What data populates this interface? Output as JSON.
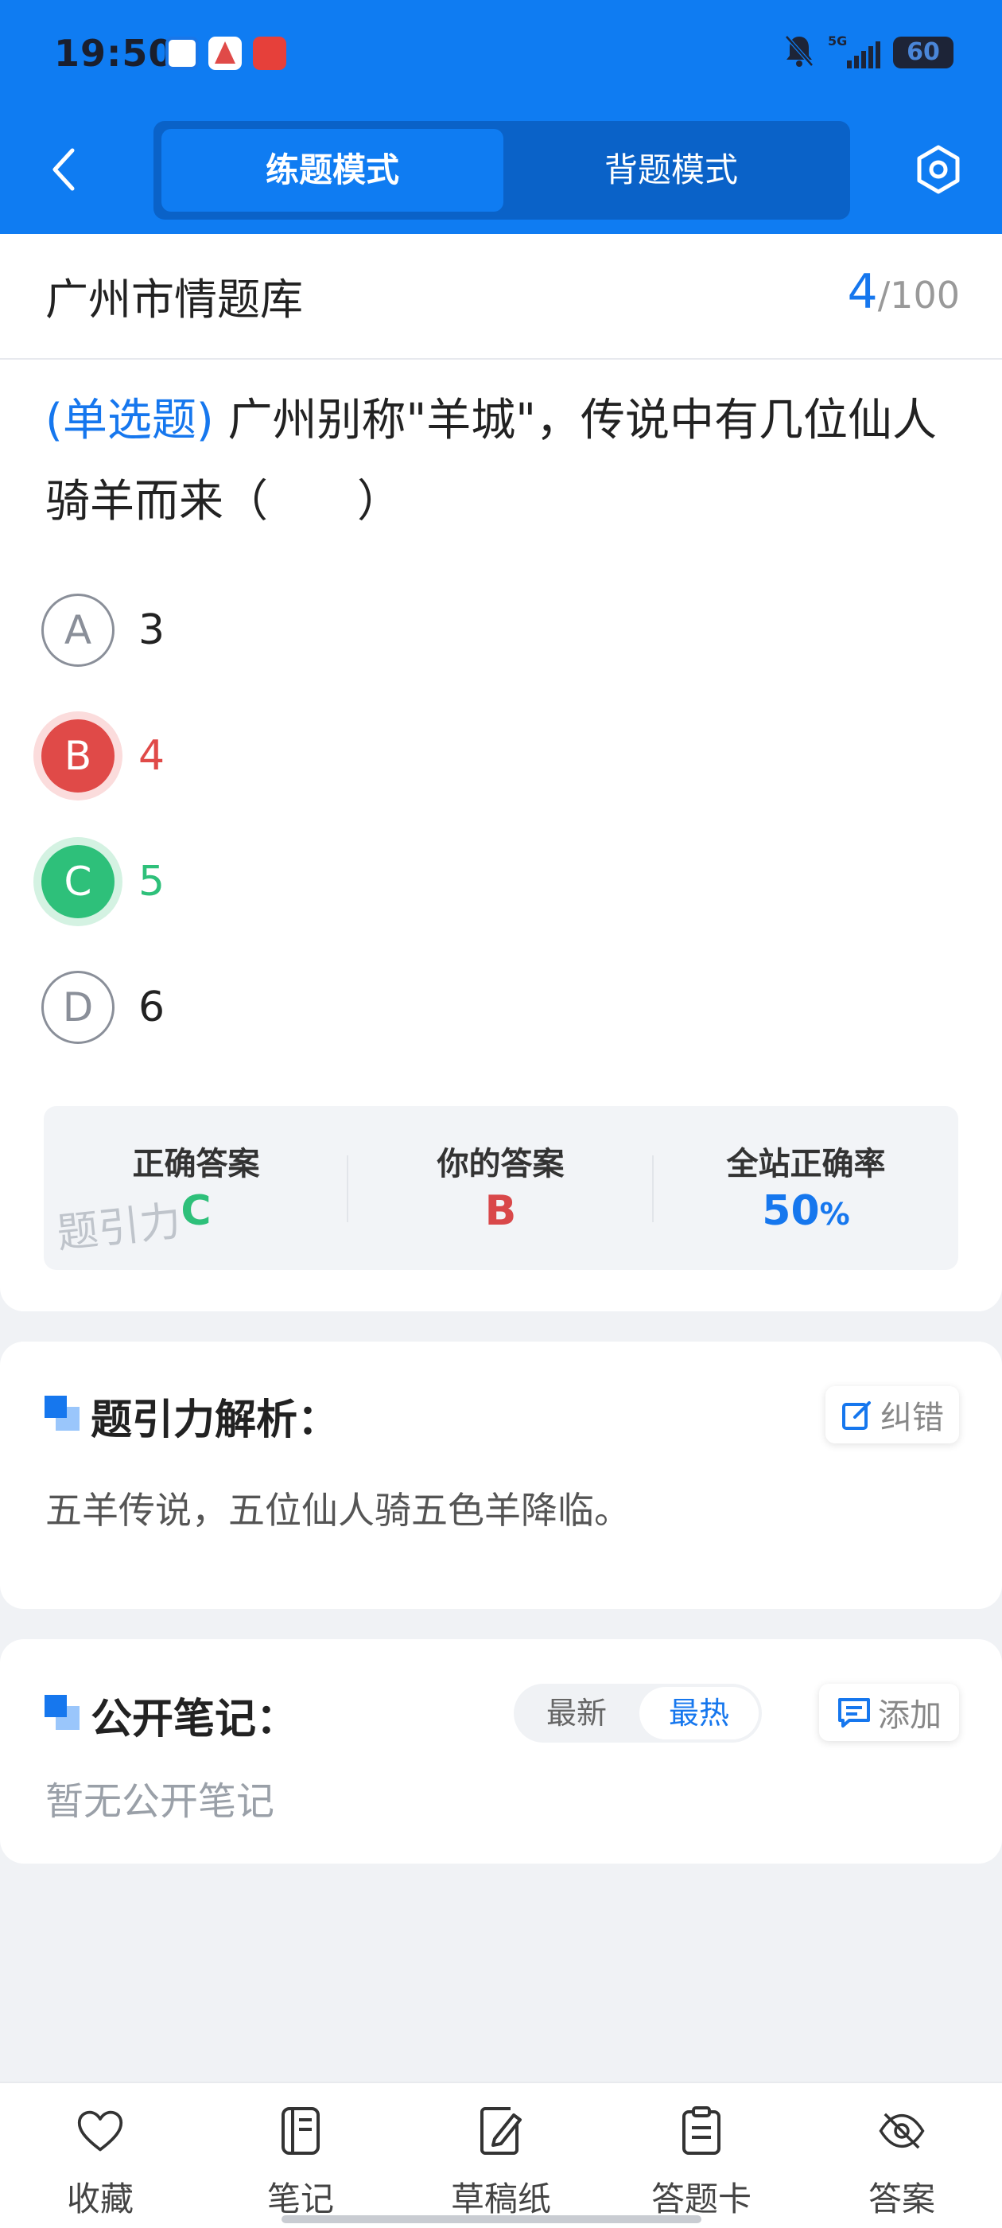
{
  "status_bar": {
    "time": "19:50",
    "network": "5G",
    "battery": "60"
  },
  "header": {
    "tabs": [
      {
        "label": "练题模式",
        "active": true
      },
      {
        "label": "背题模式",
        "active": false
      }
    ]
  },
  "question_bank": {
    "name": "广州市情题库",
    "current": "4",
    "total": "/100"
  },
  "question": {
    "type": "(单选题)",
    "text": "广州别称\"羊城\"，传说中有几位仙人骑羊而来（　　）"
  },
  "options": [
    {
      "letter": "A",
      "text": "3",
      "state": "normal"
    },
    {
      "letter": "B",
      "text": "4",
      "state": "wrong"
    },
    {
      "letter": "C",
      "text": "5",
      "state": "correct"
    },
    {
      "letter": "D",
      "text": "6",
      "state": "normal"
    }
  ],
  "answer_summary": {
    "correct_label": "正确答案",
    "correct_value": "C",
    "yours_label": "你的答案",
    "yours_value": "B",
    "rate_label": "全站正确率",
    "rate_value": "50",
    "rate_unit": "%",
    "watermark": "题引力"
  },
  "analysis": {
    "title": "题引力解析：",
    "report_label": "纠错",
    "text": "五羊传说，五位仙人骑五色羊降临。"
  },
  "notes": {
    "title": "公开笔记：",
    "sort_latest": "最新",
    "sort_hot": "最热",
    "add_label": "添加",
    "empty_text": "暂无公开笔记"
  },
  "bottom_nav": {
    "items": [
      {
        "label": "收藏",
        "icon": "heart-icon"
      },
      {
        "label": "笔记",
        "icon": "notebook-icon"
      },
      {
        "label": "草稿纸",
        "icon": "draft-icon"
      },
      {
        "label": "答题卡",
        "icon": "clipboard-icon"
      },
      {
        "label": "答案",
        "icon": "eye-off-icon"
      }
    ]
  },
  "colors": {
    "primary": "#0f7cf2",
    "accent_blue": "#1677ee",
    "wrong": "#e04a48",
    "correct": "#2ec07a"
  }
}
